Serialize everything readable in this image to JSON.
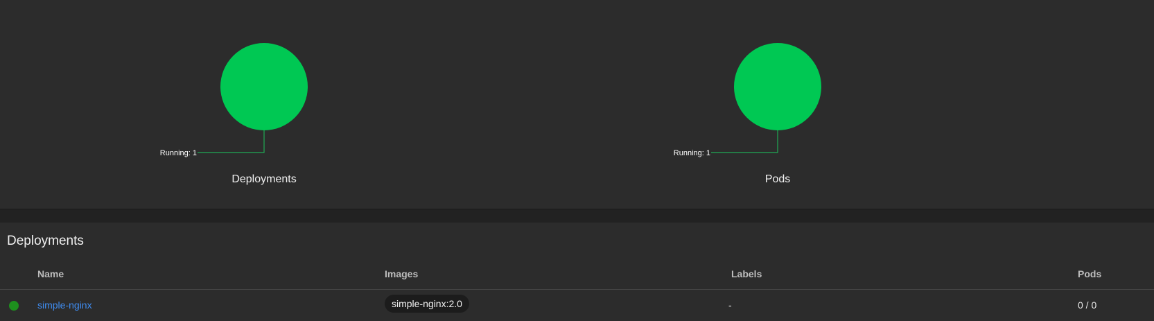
{
  "graphs": [
    {
      "title": "Deployments",
      "status_label": "Running: 1",
      "color": "#00c853",
      "running": 1
    },
    {
      "title": "Pods",
      "status_label": "Running: 1",
      "color": "#00c853",
      "running": 1
    }
  ],
  "deployments": {
    "title": "Deployments",
    "columns": [
      "Name",
      "Images",
      "Labels",
      "Pods"
    ],
    "rows": [
      {
        "status": "running",
        "status_color": "#1e8f1e",
        "name": "simple-nginx",
        "image": "simple-nginx:2.0",
        "labels": "-",
        "pods": "0 / 0"
      }
    ]
  }
}
